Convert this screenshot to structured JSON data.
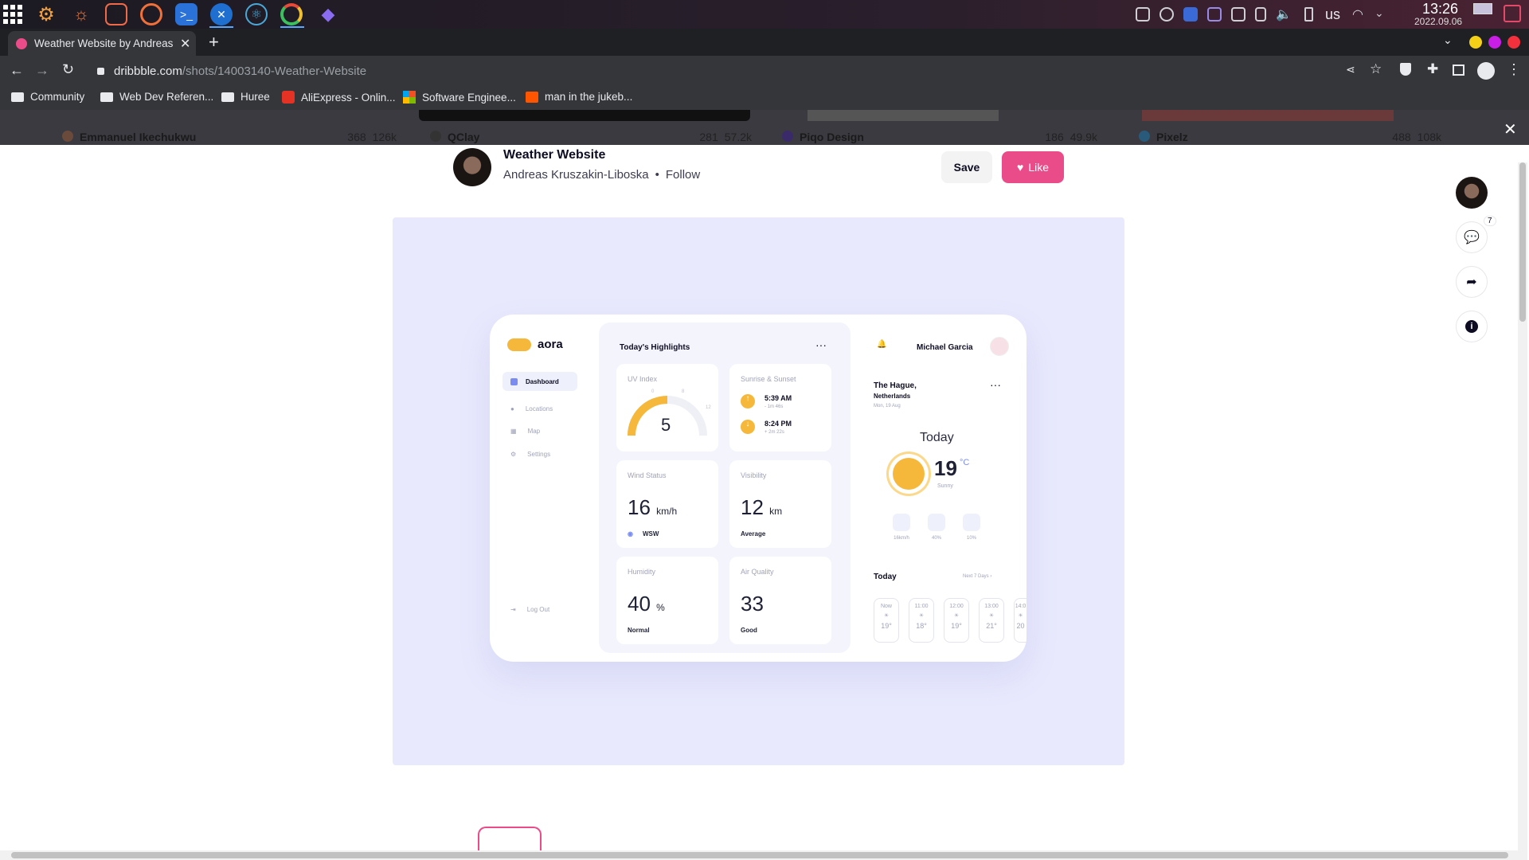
{
  "taskbar": {
    "time": "13:26",
    "date": "2022.09.06",
    "keyboard_layout": "us",
    "app_icons": [
      "settings-icon",
      "wifi-cast-icon",
      "folder-icon",
      "podcast-icon",
      "terminal-icon",
      "vscode-icon",
      "electron-icon",
      "chrome-icon",
      "crystal-icon"
    ]
  },
  "browser": {
    "tab_title": "Weather Website by Andreas",
    "url_domain": "dribbble.com",
    "url_path": "/shots/14003140-Weather-Website",
    "bookmarks": [
      {
        "label": "Community",
        "icon": "folder-icon"
      },
      {
        "label": "Web Dev Referen...",
        "icon": "folder-icon"
      },
      {
        "label": "Huree",
        "icon": "folder-icon"
      },
      {
        "label": "AliExpress - Onlin...",
        "icon": "aliexpress-icon"
      },
      {
        "label": "Software Enginee...",
        "icon": "microsoft-icon"
      },
      {
        "label": "man in the jukeb...",
        "icon": "soundcloud-icon"
      }
    ]
  },
  "backdrop": {
    "items": [
      {
        "name": "Emmanuel Ikechukwu",
        "likes": "368",
        "views": "126k"
      },
      {
        "name": "QClay",
        "likes": "281",
        "views": "57.2k"
      },
      {
        "name": "Piqo Design",
        "likes": "186",
        "views": "49.9k"
      },
      {
        "name": "Pixelz",
        "likes": "488",
        "views": "108k"
      }
    ]
  },
  "shot_header": {
    "title": "Weather Website",
    "author": "Andreas Kruszakin-Liboska",
    "follow": "Follow",
    "save": "Save",
    "like": "Like",
    "comment_count": "7"
  },
  "dashboard": {
    "brand": "aora",
    "nav": [
      "Dashboard",
      "Locations",
      "Map",
      "Settings"
    ],
    "logout": "Log Out",
    "highlights_title": "Today's Highlights",
    "uv": {
      "label": "UV Index",
      "value": "5",
      "ticks": [
        "0",
        "8",
        "12"
      ]
    },
    "sun": {
      "label": "Sunrise & Sunset",
      "sunrise": "5:39 AM",
      "sunrise_delta": "- 1m 46s",
      "sunset": "8:24 PM",
      "sunset_delta": "+ 2m 22s"
    },
    "wind": {
      "label": "Wind Status",
      "value": "16",
      "unit": "km/h",
      "dir": "WSW"
    },
    "visibility": {
      "label": "Visibility",
      "value": "12",
      "unit": "km",
      "status": "Average"
    },
    "humidity": {
      "label": "Humidity",
      "value": "40",
      "unit": "%",
      "status": "Normal"
    },
    "air": {
      "label": "Air Quality",
      "value": "33",
      "status": "Good"
    },
    "user": "Michael Garcia",
    "city": "The Hague,",
    "country": "Netherlands",
    "date": "Mon, 19 Aug",
    "today": "Today",
    "temp": "19",
    "temp_unit": "°C",
    "condition": "Sunny",
    "stats": [
      "16km/h",
      "40%",
      "10%"
    ],
    "forecast_title": "Today",
    "next_days": "Next 7 Days",
    "hours": [
      {
        "time": "Now",
        "temp": "19°"
      },
      {
        "time": "11:00",
        "temp": "18°"
      },
      {
        "time": "12:00",
        "temp": "19°"
      },
      {
        "time": "13:00",
        "temp": "21°"
      },
      {
        "time": "14:0",
        "temp": "20"
      }
    ]
  }
}
